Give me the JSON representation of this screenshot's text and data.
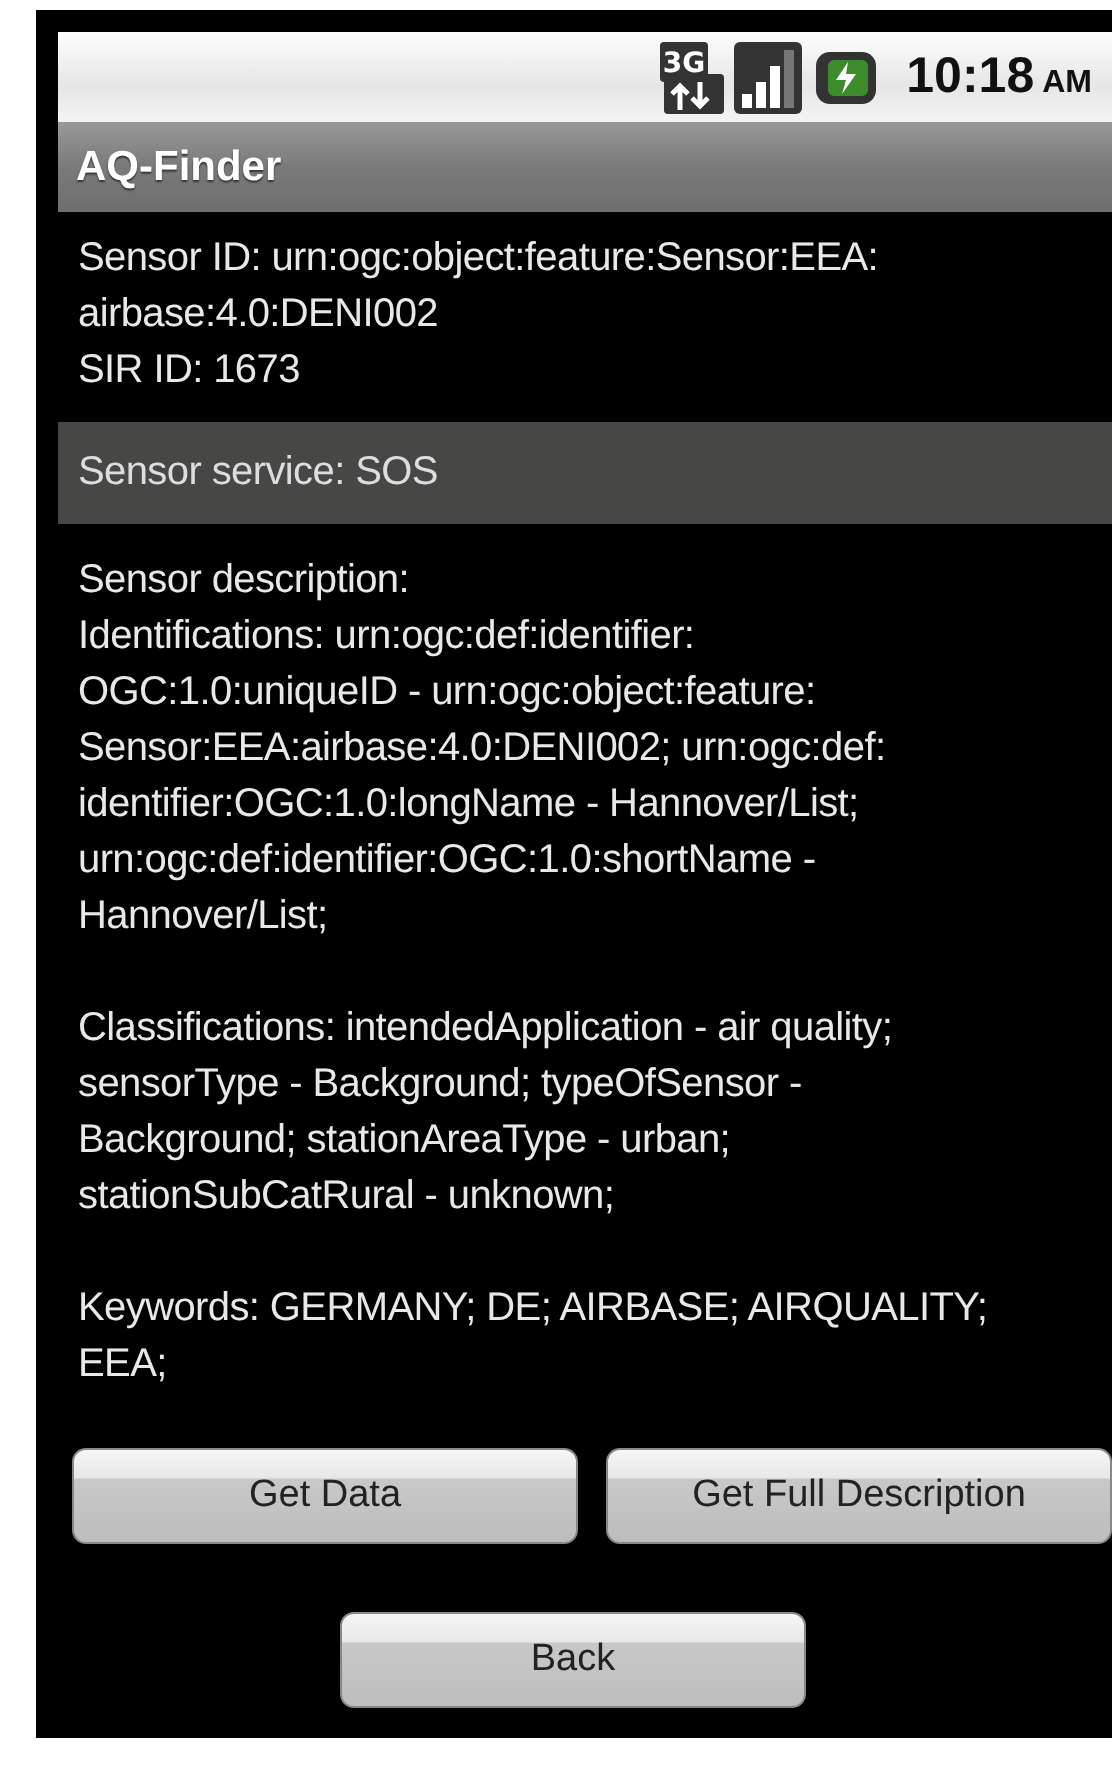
{
  "status_bar": {
    "network": "3G",
    "time": "10:18",
    "time_suffix": "AM"
  },
  "title_bar": {
    "title": "AQ-Finder"
  },
  "sensor_info": [
    {
      "lines": [
        "Sensor ID: urn:ogc:object:feature:Sensor:EEA:",
        "airbase:4.0:DENI002"
      ]
    },
    {
      "lines": [
        "SIR ID: 1673"
      ]
    }
  ],
  "service_bar": {
    "text": "Sensor service: SOS"
  },
  "description": [
    {
      "lines": [
        "Sensor description:",
        "Identifications: urn:ogc:def:identifier:",
        "OGC:1.0:uniqueID - urn:ogc:object:feature:",
        "Sensor:EEA:airbase:4.0:DENI002; urn:ogc:def:",
        "identifier:OGC:1.0:longName - Hannover/List;",
        "urn:ogc:def:identifier:OGC:1.0:shortName -",
        "Hannover/List;"
      ]
    },
    {
      "lines": [
        "Classifications: intendedApplication - air quality;",
        "sensorType - Background; typeOfSensor -",
        "Background; stationAreaType - urban;",
        "stationSubCatRural - unknown;"
      ]
    },
    {
      "lines": [
        "Keywords: GERMANY; DE; AIRBASE; AIRQUALITY;",
        "EEA;"
      ]
    }
  ],
  "buttons": [
    {
      "label": "Get Data"
    },
    {
      "label": "Get Full Description"
    }
  ],
  "back_button": {
    "label": "Back"
  }
}
